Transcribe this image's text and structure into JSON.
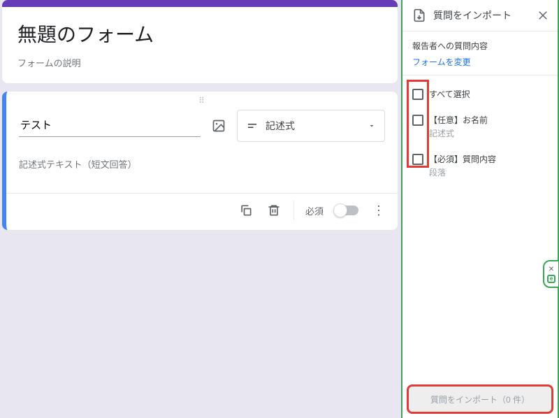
{
  "form": {
    "title": "無題のフォーム",
    "description": "フォームの説明"
  },
  "question": {
    "title": "テスト",
    "type_label": "記述式",
    "answer_placeholder": "記述式テキスト（短文回答）",
    "required_label": "必須"
  },
  "import_panel": {
    "title": "質問をインポート",
    "source_label": "報告者への質問内容",
    "change_form": "フォームを変更",
    "select_all": "すべて選択",
    "items": [
      {
        "title": "【任意】お名前",
        "subtype": "記述式"
      },
      {
        "title": "【必須】質問内容",
        "subtype": "段落"
      }
    ],
    "import_button": "質問をインポート（0 件）"
  }
}
